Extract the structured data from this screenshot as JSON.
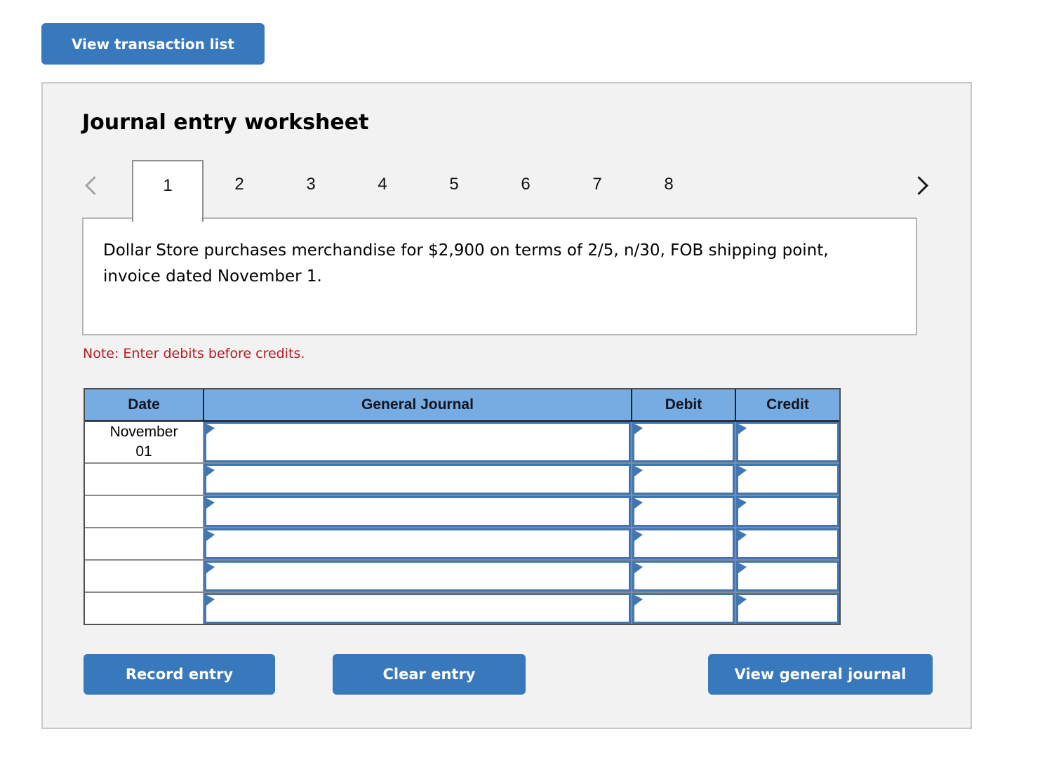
{
  "toolbar": {
    "view_transaction_list_label": "View transaction list"
  },
  "worksheet": {
    "title": "Journal entry worksheet",
    "tabs": {
      "items": [
        "1",
        "2",
        "3",
        "4",
        "5",
        "6",
        "7",
        "8"
      ],
      "active": "1",
      "prev_icon": "chevron-left",
      "next_icon": "chevron-right"
    },
    "description": "Dollar Store purchases merchandise for $2,900 on terms of 2/5, n/30, FOB shipping point, invoice dated November 1.",
    "note": "Note: Enter debits before credits.",
    "table": {
      "headers": [
        "Date",
        "General Journal",
        "Debit",
        "Credit"
      ],
      "rows": [
        {
          "date": "November 01",
          "general_journal": "",
          "debit": "",
          "credit": ""
        },
        {
          "date": "",
          "general_journal": "",
          "debit": "",
          "credit": ""
        },
        {
          "date": "",
          "general_journal": "",
          "debit": "",
          "credit": ""
        },
        {
          "date": "",
          "general_journal": "",
          "debit": "",
          "credit": ""
        },
        {
          "date": "",
          "general_journal": "",
          "debit": "",
          "credit": ""
        },
        {
          "date": "",
          "general_journal": "",
          "debit": "",
          "credit": ""
        }
      ]
    },
    "footer": {
      "record_entry_label": "Record entry",
      "clear_entry_label": "Clear entry",
      "view_general_journal_label": "View general journal"
    }
  },
  "colors": {
    "button_blue": "#3878bc",
    "table_header_blue": "#76ace1",
    "cell_border_blue": "#4176b2",
    "note_red": "#b21e23",
    "panel_gray": "#f2f2f2"
  }
}
